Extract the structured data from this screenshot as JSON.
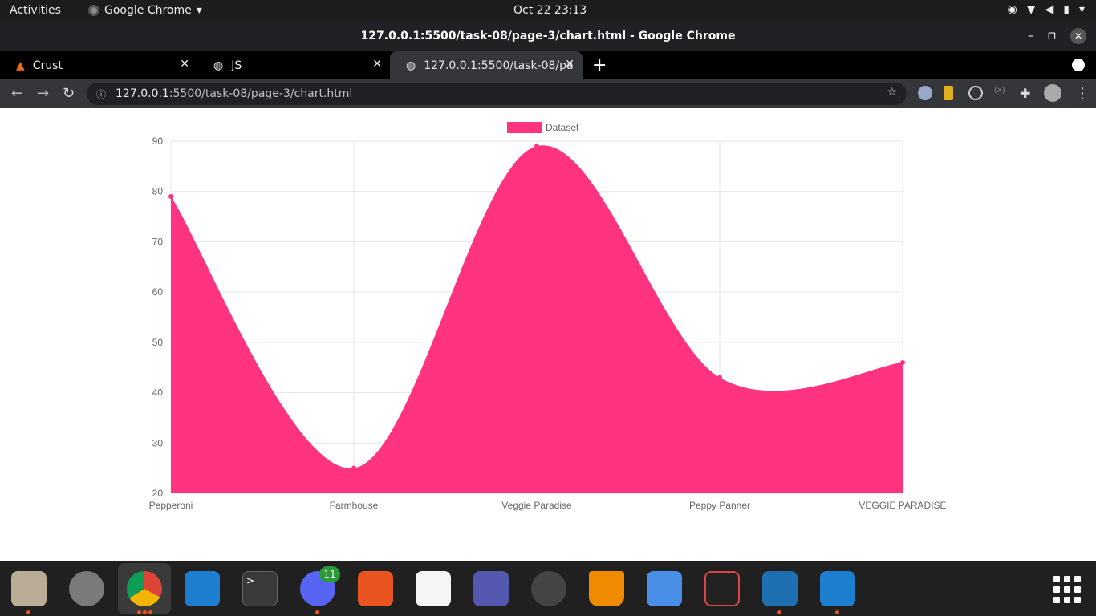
{
  "system": {
    "activities": "Activities",
    "app_name": "Google Chrome",
    "clock": "Oct 22  23:13"
  },
  "window": {
    "title": "127.0.0.1:5500/task-08/page-3/chart.html - Google Chrome"
  },
  "tabs": [
    {
      "label": "Crust"
    },
    {
      "label": "JS"
    },
    {
      "label": "127.0.0.1:5500/task-08/pa"
    }
  ],
  "address": {
    "host": "127.0.0.1",
    "path": ":5500/task-08/page-3/chart.html"
  },
  "dock": {
    "discord_badge": "11"
  },
  "chart_data": {
    "type": "area",
    "categories": [
      "Pepperoni",
      "Farmhouse",
      "Veggie Paradise",
      "Peppy Panner",
      "VEGGIE PARADISE"
    ],
    "series": [
      {
        "name": "Dataset",
        "values": [
          79,
          25,
          89,
          43,
          46
        ]
      }
    ],
    "ylim": [
      20,
      90
    ],
    "yticks": [
      90,
      80,
      70,
      60,
      50,
      40,
      30,
      20
    ],
    "grid": true,
    "legend": "top-center",
    "color": "#ff3380"
  }
}
